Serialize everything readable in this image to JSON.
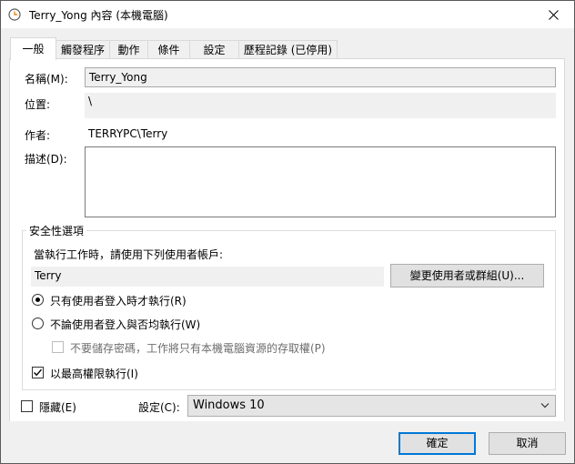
{
  "window": {
    "title": "Terry_Yong 內容 (本機電腦)"
  },
  "tabs": [
    {
      "label": "一般",
      "active": true
    },
    {
      "label": "觸發程序",
      "active": false
    },
    {
      "label": "動作",
      "active": false
    },
    {
      "label": "條件",
      "active": false
    },
    {
      "label": "設定",
      "active": false
    },
    {
      "label": "歷程記錄 (已停用)",
      "active": false
    }
  ],
  "general": {
    "name_label": "名稱(M):",
    "name_value": "Terry_Yong",
    "location_label": "位置:",
    "location_value": "\\",
    "author_label": "作者:",
    "author_value": "TERRYPC\\Terry",
    "description_label": "描述(D):",
    "description_value": ""
  },
  "security": {
    "group_title": "安全性選項",
    "run_as_prompt": "當執行工作時，請使用下列使用者帳戶:",
    "user_account": "Terry",
    "change_user_button": "變更使用者或群組(U)...",
    "radio_logged_on": "只有使用者登入時才執行(R)",
    "radio_whether": "不論使用者登入與否均執行(W)",
    "radio_selected": "logged_on",
    "no_store_password": "不要儲存密碼，工作將只有本機電腦資源的存取權(P)",
    "highest_privileges": "以最高權限執行(I)",
    "highest_privileges_checked": true
  },
  "footer": {
    "hidden_label": "隱藏(E)",
    "hidden_checked": false,
    "configure_label": "設定(C):",
    "configure_value": "Windows 10"
  },
  "buttons": {
    "ok": "確定",
    "cancel": "取消"
  },
  "colors": {
    "accent": "#0078d7"
  }
}
